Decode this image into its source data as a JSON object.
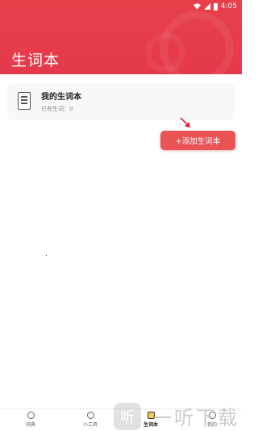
{
  "status_bar": {
    "time": "4:05"
  },
  "header": {
    "title": "生词本"
  },
  "vocab_card": {
    "title": "我的生词本",
    "subtitle": "已有生词：0"
  },
  "add_button": {
    "label": "+添加生词本"
  },
  "bottom_nav": {
    "items": [
      {
        "label": "词典",
        "icon": "dictionary-icon",
        "active": false
      },
      {
        "label": "小工具",
        "icon": "tools-icon",
        "active": false
      },
      {
        "label": "生词本",
        "icon": "vocab-book-icon",
        "active": true
      },
      {
        "label": "我的",
        "icon": "profile-icon",
        "active": false
      }
    ]
  },
  "watermark": {
    "logo": "听",
    "text": "一听下载"
  },
  "colors": {
    "header": "#e4394a",
    "button": "#eb5457"
  }
}
